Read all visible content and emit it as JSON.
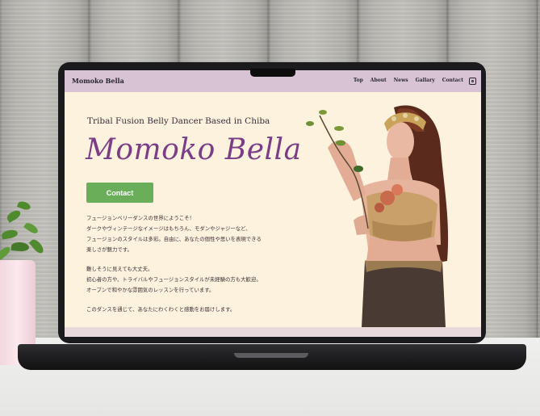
{
  "site": {
    "brand": "Momoko Bella",
    "nav": [
      "Top",
      "About",
      "News",
      "Gallary",
      "Contact"
    ],
    "instagram_icon": "instagram-icon"
  },
  "hero": {
    "tagline": "Tribal Fusion Belly Dancer Based in Chiba",
    "title": "Momoko Bella",
    "contact_label": "Contact"
  },
  "intro": {
    "p1": [
      "フュージョンベリーダンスの世界にようこそ！",
      "ダークやヴィンテージなイメージはもちろん、モダンやジャジーなど、",
      "フュージョンのスタイルは多彩。自由に、あなたの個性や思いを表現できる",
      "楽しさが魅力です。"
    ],
    "p2": [
      "難しそうに見えても大丈夫。",
      "初心者の方や、トライバルやフュージョンスタイルが未経験の方も大歓迎。",
      "オープンで和やかな雰囲気のレッスンを行っています。"
    ],
    "p3": [
      "このダンスを通じて、あなたにわくわくと感動をお届けします。"
    ]
  },
  "colors": {
    "navbar": "#d7c3d4",
    "page_bg": "#fcf2de",
    "title": "#7a3d86",
    "button": "#6aae5a"
  }
}
